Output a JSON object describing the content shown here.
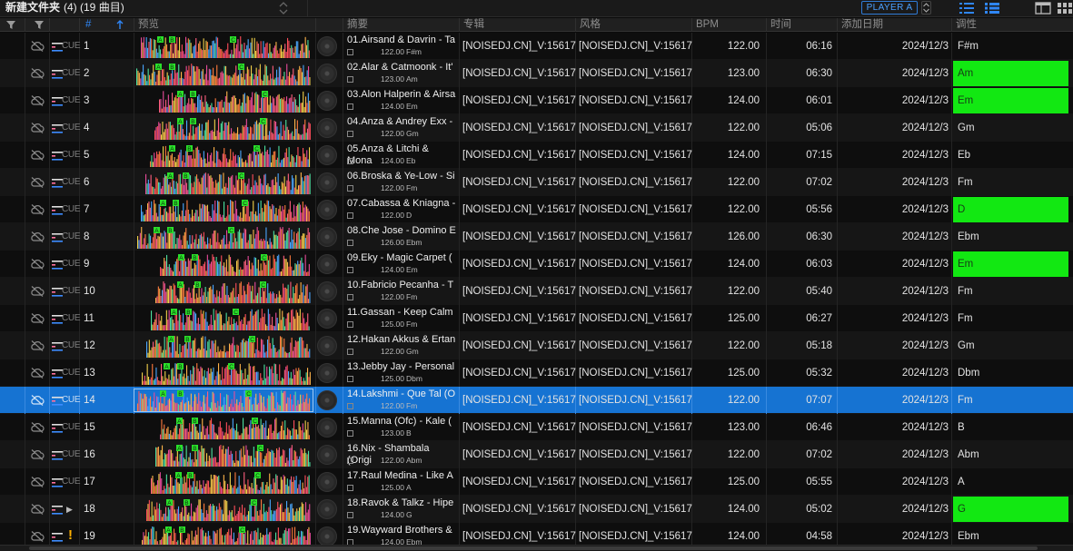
{
  "topbar": {
    "folder_name": "新建文件夹",
    "folder_count": "(4) (19 曲目)",
    "player_label": "PLAYER A"
  },
  "columns": {
    "num": "#",
    "preview": "预览",
    "summary": "摘要",
    "album": "专辑",
    "genre": "风格",
    "bpm": "BPM",
    "time": "时间",
    "date_added": "添加日期",
    "key": "调性"
  },
  "icons": {
    "filter": "filter-icon",
    "cloud_off": "cloud-off-icon",
    "sort_up": "sort-arrow-up-icon",
    "list_view": "list-view-icon",
    "grid_view": "grid-view-icon"
  },
  "colors": {
    "selection": "#1673d2",
    "key_highlight": "#12e812",
    "accent_blue": "#2f86f6"
  },
  "tracks": [
    {
      "num": "1",
      "title": "01.Airsand & Davrin - Ta",
      "bpm_sub": "122.00",
      "key_sub": "F#m",
      "album": "[NOISEDJ.CN]_V:15617",
      "genre": "[NOISEDJ.CN]_V:15617",
      "bpm": "122.00",
      "time": "06:16",
      "date": "2024/12/3",
      "key": "F#m",
      "key_highlight": false,
      "selected": false,
      "status": "cue"
    },
    {
      "num": "2",
      "title": "02.Alar & Catmoonk - It'",
      "bpm_sub": "123.00",
      "key_sub": "Am",
      "album": "[NOISEDJ.CN]_V:15617",
      "genre": "[NOISEDJ.CN]_V:15617",
      "bpm": "123.00",
      "time": "06:30",
      "date": "2024/12/3",
      "key": "Am",
      "key_highlight": true,
      "selected": false,
      "status": "cue"
    },
    {
      "num": "3",
      "title": "03.Alon Halperin & Airsa",
      "bpm_sub": "124.00",
      "key_sub": "Em",
      "album": "[NOISEDJ.CN]_V:15617",
      "genre": "[NOISEDJ.CN]_V:15617",
      "bpm": "124.00",
      "time": "06:01",
      "date": "2024/12/3",
      "key": "Em",
      "key_highlight": true,
      "selected": false,
      "status": "cue"
    },
    {
      "num": "4",
      "title": "04.Anza & Andrey Exx -",
      "bpm_sub": "122.00",
      "key_sub": "Gm",
      "album": "[NOISEDJ.CN]_V:15617",
      "genre": "[NOISEDJ.CN]_V:15617",
      "bpm": "122.00",
      "time": "05:06",
      "date": "2024/12/3",
      "key": "Gm",
      "key_highlight": false,
      "selected": false,
      "status": "cue"
    },
    {
      "num": "5",
      "title": "05.Anza & Litchi & Mona",
      "bpm_sub": "124.00",
      "key_sub": "Eb",
      "album": "[NOISEDJ.CN]_V:15617",
      "genre": "[NOISEDJ.CN]_V:15617",
      "bpm": "124.00",
      "time": "07:15",
      "date": "2024/12/3",
      "key": "Eb",
      "key_highlight": false,
      "selected": false,
      "status": "cue"
    },
    {
      "num": "6",
      "title": "06.Broska & Ye-Low - Si",
      "bpm_sub": "122.00",
      "key_sub": "Fm",
      "album": "[NOISEDJ.CN]_V:15617",
      "genre": "[NOISEDJ.CN]_V:15617",
      "bpm": "122.00",
      "time": "07:02",
      "date": "2024/12/3",
      "key": "Fm",
      "key_highlight": false,
      "selected": false,
      "status": "cue"
    },
    {
      "num": "7",
      "title": "07.Cabassa & Kniagna -",
      "bpm_sub": "122.00",
      "key_sub": "D",
      "album": "[NOISEDJ.CN]_V:15617",
      "genre": "[NOISEDJ.CN]_V:15617",
      "bpm": "122.00",
      "time": "05:56",
      "date": "2024/12/3",
      "key": "D",
      "key_highlight": true,
      "selected": false,
      "status": "cue"
    },
    {
      "num": "8",
      "title": "08.Che Jose - Domino E",
      "bpm_sub": "126.00",
      "key_sub": "Ebm",
      "album": "[NOISEDJ.CN]_V:15617",
      "genre": "[NOISEDJ.CN]_V:15617",
      "bpm": "126.00",
      "time": "06:30",
      "date": "2024/12/3",
      "key": "Ebm",
      "key_highlight": false,
      "selected": false,
      "status": "cue"
    },
    {
      "num": "9",
      "title": "09.Eky - Magic Carpet (",
      "bpm_sub": "124.00",
      "key_sub": "Em",
      "album": "[NOISEDJ.CN]_V:15617",
      "genre": "[NOISEDJ.CN]_V:15617",
      "bpm": "124.00",
      "time": "06:03",
      "date": "2024/12/3",
      "key": "Em",
      "key_highlight": true,
      "selected": false,
      "status": "cue"
    },
    {
      "num": "10",
      "title": "10.Fabricio Pecanha - T",
      "bpm_sub": "122.00",
      "key_sub": "Fm",
      "album": "[NOISEDJ.CN]_V:15617",
      "genre": "[NOISEDJ.CN]_V:15617",
      "bpm": "122.00",
      "time": "05:40",
      "date": "2024/12/3",
      "key": "Fm",
      "key_highlight": false,
      "selected": false,
      "status": "cue"
    },
    {
      "num": "11",
      "title": "11.Gassan - Keep Calm",
      "bpm_sub": "125.00",
      "key_sub": "Fm",
      "album": "[NOISEDJ.CN]_V:15617",
      "genre": "[NOISEDJ.CN]_V:15617",
      "bpm": "125.00",
      "time": "06:27",
      "date": "2024/12/3",
      "key": "Fm",
      "key_highlight": false,
      "selected": false,
      "status": "cue"
    },
    {
      "num": "12",
      "title": "12.Hakan Akkus & Ertan",
      "bpm_sub": "122.00",
      "key_sub": "Gm",
      "album": "[NOISEDJ.CN]_V:15617",
      "genre": "[NOISEDJ.CN]_V:15617",
      "bpm": "122.00",
      "time": "05:18",
      "date": "2024/12/3",
      "key": "Gm",
      "key_highlight": false,
      "selected": false,
      "status": "cue"
    },
    {
      "num": "13",
      "title": "13.Jebby Jay - Personal",
      "bpm_sub": "125.00",
      "key_sub": "Dbm",
      "album": "[NOISEDJ.CN]_V:15617",
      "genre": "[NOISEDJ.CN]_V:15617",
      "bpm": "125.00",
      "time": "05:32",
      "date": "2024/12/3",
      "key": "Dbm",
      "key_highlight": false,
      "selected": false,
      "status": "cue"
    },
    {
      "num": "14",
      "title": "14.Lakshmi - Que Tal (O",
      "bpm_sub": "122.00",
      "key_sub": "Fm",
      "album": "[NOISEDJ.CN]_V:15617",
      "genre": "[NOISEDJ.CN]_V:15617",
      "bpm": "122.00",
      "time": "07:07",
      "date": "2024/12/3",
      "key": "Fm",
      "key_highlight": false,
      "selected": true,
      "status": "cue"
    },
    {
      "num": "15",
      "title": "15.Manna (Ofc) - Kale (",
      "bpm_sub": "123.00",
      "key_sub": "B",
      "album": "[NOISEDJ.CN]_V:15617",
      "genre": "[NOISEDJ.CN]_V:15617",
      "bpm": "123.00",
      "time": "06:46",
      "date": "2024/12/3",
      "key": "B",
      "key_highlight": false,
      "selected": false,
      "status": "cue"
    },
    {
      "num": "16",
      "title": "16.Nix - Shambala (Origi",
      "bpm_sub": "122.00",
      "key_sub": "Abm",
      "album": "[NOISEDJ.CN]_V:15617",
      "genre": "[NOISEDJ.CN]_V:15617",
      "bpm": "122.00",
      "time": "07:02",
      "date": "2024/12/3",
      "key": "Abm",
      "key_highlight": false,
      "selected": false,
      "status": "cue"
    },
    {
      "num": "17",
      "title": "17.Raul Medina - Like A",
      "bpm_sub": "125.00",
      "key_sub": "A",
      "album": "[NOISEDJ.CN]_V:15617",
      "genre": "[NOISEDJ.CN]_V:15617",
      "bpm": "125.00",
      "time": "05:55",
      "date": "2024/12/3",
      "key": "A",
      "key_highlight": false,
      "selected": false,
      "status": "cue"
    },
    {
      "num": "18",
      "title": "18.Ravok & Talkz - Hipe",
      "bpm_sub": "124.00",
      "key_sub": "G",
      "album": "[NOISEDJ.CN]_V:15617",
      "genre": "[NOISEDJ.CN]_V:15617",
      "bpm": "124.00",
      "time": "05:02",
      "date": "2024/12/3",
      "key": "G",
      "key_highlight": true,
      "selected": false,
      "status": "play"
    },
    {
      "num": "19",
      "title": "19.Wayward Brothers &",
      "bpm_sub": "124.00",
      "key_sub": "Ebm",
      "album": "[NOISEDJ.CN]_V:15617",
      "genre": "[NOISEDJ.CN]_V:15617",
      "bpm": "124.00",
      "time": "04:58",
      "date": "2024/12/3",
      "key": "Ebm",
      "key_highlight": false,
      "selected": false,
      "status": "warn"
    }
  ],
  "cue_label": "CUE",
  "play_glyph": "▶",
  "warn_glyph": "!"
}
